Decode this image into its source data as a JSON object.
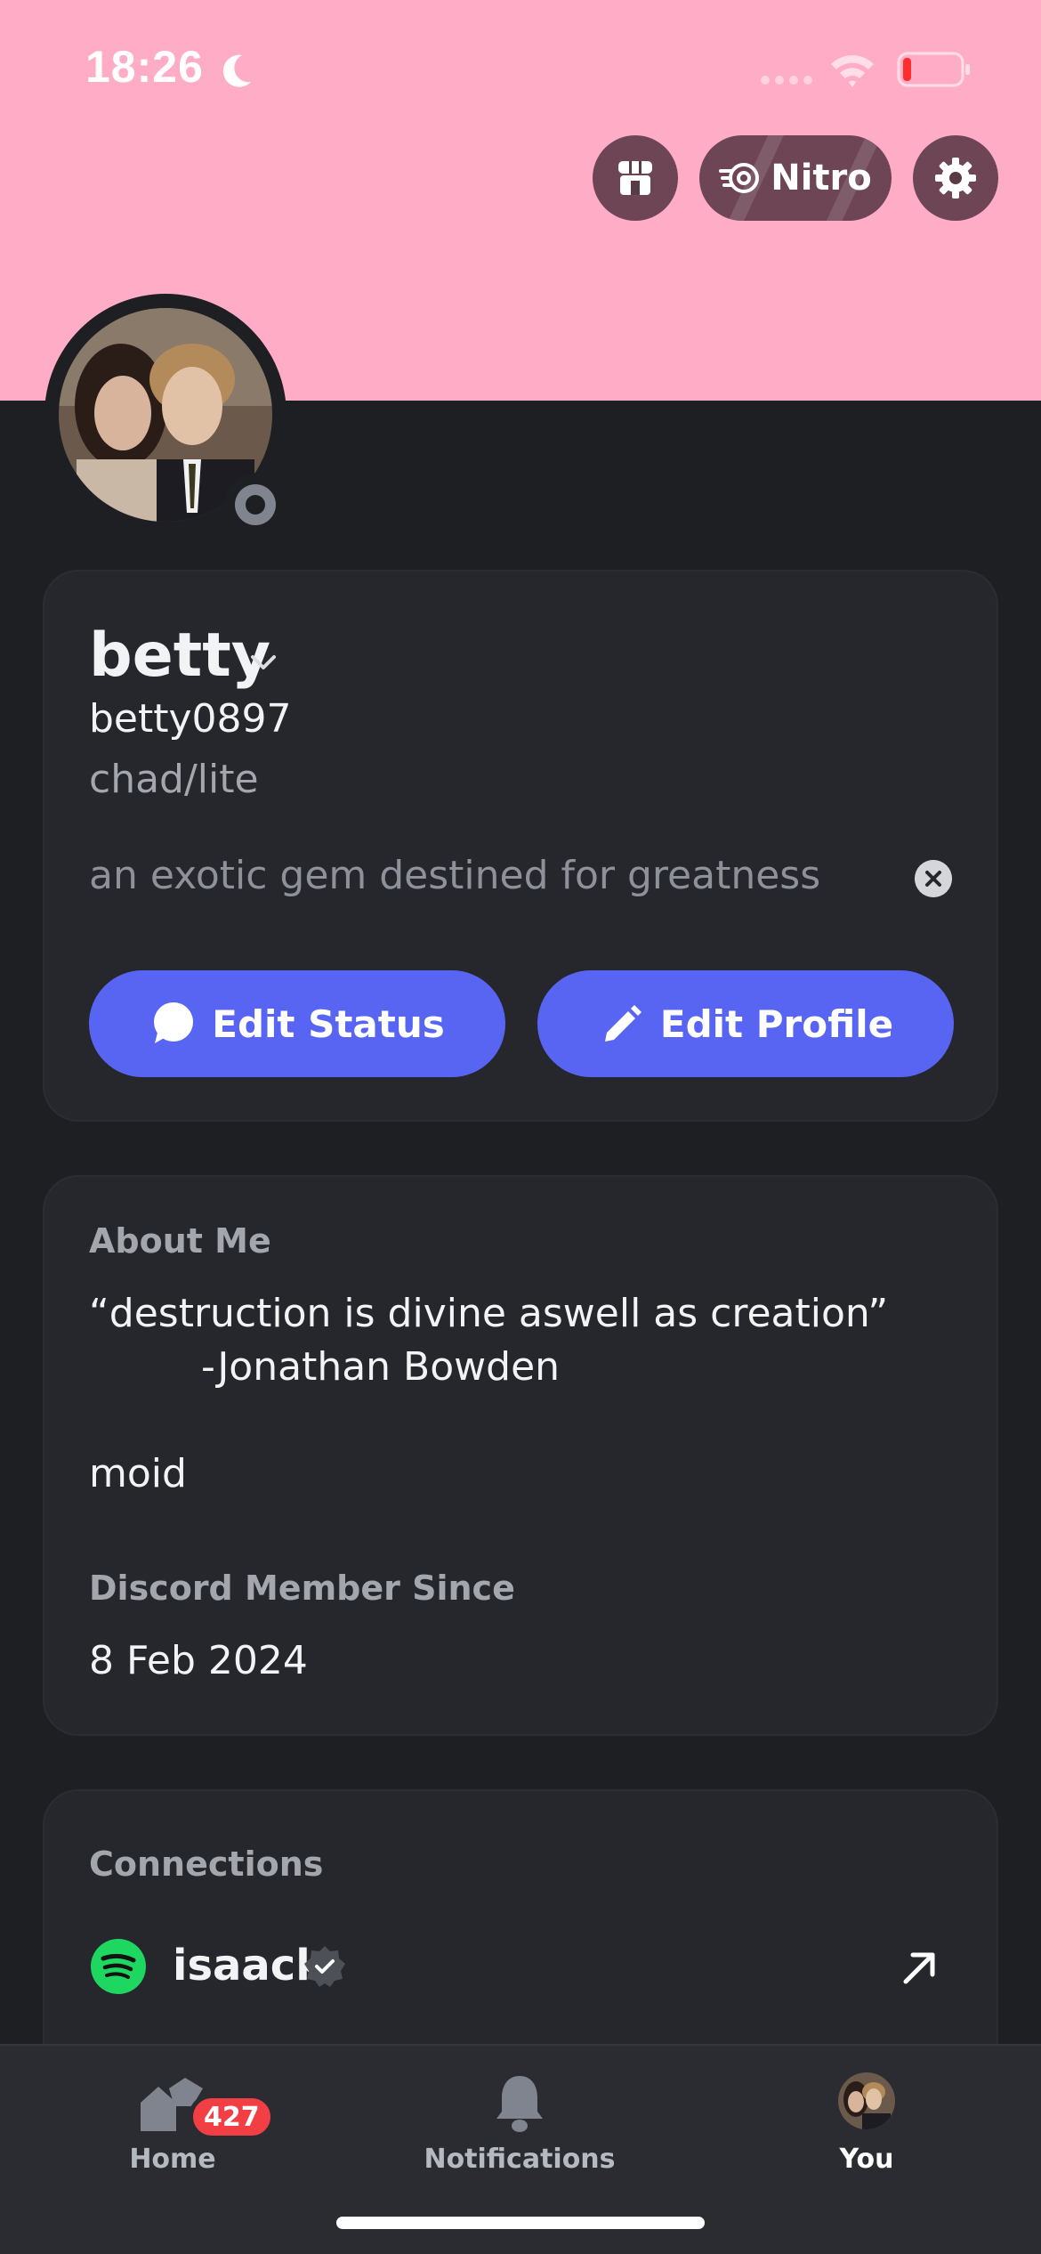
{
  "status_bar": {
    "time": "18:26"
  },
  "header": {
    "nitro_label": "Nitro"
  },
  "profile": {
    "display_name": "betty",
    "username": "betty0897",
    "pronouns": "chad/lite",
    "custom_status": "an exotic gem destined for greatness",
    "edit_status_label": "Edit Status",
    "edit_profile_label": "Edit Profile"
  },
  "about": {
    "heading": "About Me",
    "lines": [
      "“destruction is divine aswell as creation”",
      "-Jonathan Bowden",
      "moid"
    ],
    "member_since_heading": "Discord Member Since",
    "member_since_date": "8 Feb 2024"
  },
  "connections": {
    "heading": "Connections",
    "items": [
      {
        "service": "spotify",
        "name": "isaack",
        "verified": true
      }
    ]
  },
  "bottom_nav": {
    "home_label": "Home",
    "home_badge": "427",
    "notifications_label": "Notifications",
    "you_label": "You"
  },
  "colors": {
    "banner": "#ffadc7",
    "background": "#1e1f23",
    "card": "#26272d",
    "accent": "#5865f2",
    "badge": "#f23f43",
    "spotify": "#1ed760"
  }
}
